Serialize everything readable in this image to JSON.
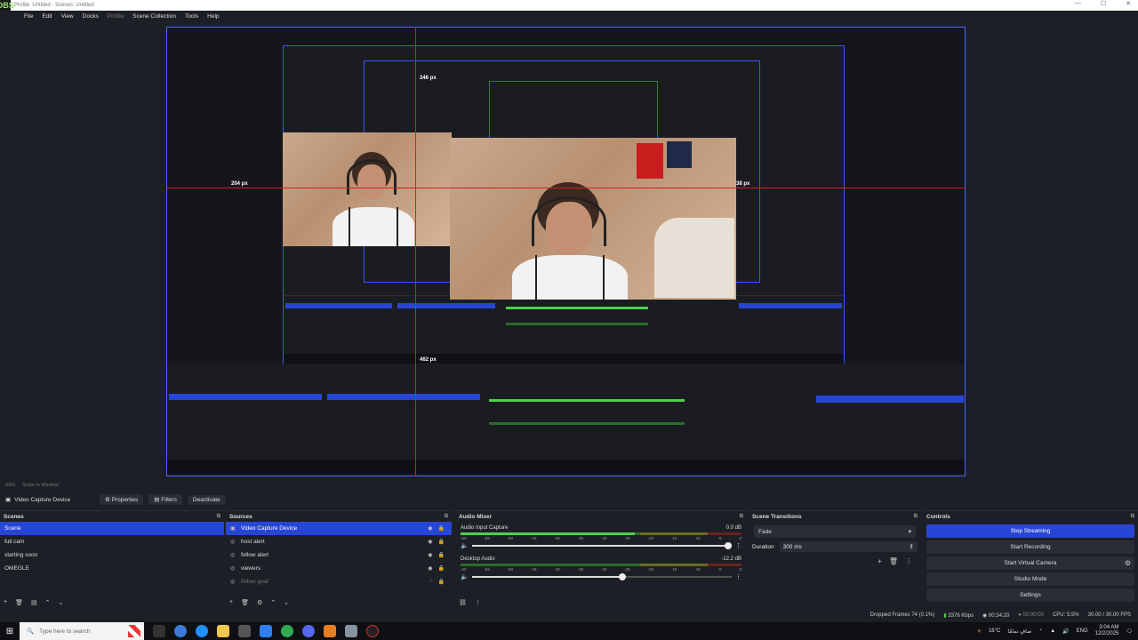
{
  "window": {
    "title": "Profile: Untitled - Scenes: Untitled",
    "logo": "OBS",
    "minimize": "—",
    "maximize": "☐",
    "close": "✕"
  },
  "menu": [
    {
      "label": "File"
    },
    {
      "label": "Edit"
    },
    {
      "label": "View"
    },
    {
      "label": "Docks"
    },
    {
      "label": "Profile"
    },
    {
      "label": "Scene Collection"
    },
    {
      "label": "Tools"
    },
    {
      "label": "Help"
    }
  ],
  "preview": {
    "labels": {
      "top": "346 px",
      "left": "204 px",
      "right": "38 px",
      "bottom": "462 px"
    }
  },
  "zoom": {
    "value": "93%",
    "mode": "Scale to Window"
  },
  "source_toolbar": {
    "source_name": "Video Capture Device",
    "properties": "Properties",
    "filters": "Filters",
    "deactivate": "Deactivate"
  },
  "scenes": {
    "title": "Scenes",
    "items": [
      "Scene",
      "full cam",
      "starting soon",
      "OMEGLE"
    ],
    "selected_index": 0
  },
  "sources": {
    "title": "Sources",
    "items": [
      {
        "name": "Video Capture Device",
        "icon": "camera-icon",
        "selected": true,
        "visible": true
      },
      {
        "name": "host alert",
        "icon": "browser-icon",
        "selected": false,
        "visible": true
      },
      {
        "name": "follow alert",
        "icon": "browser-icon",
        "selected": false,
        "visible": true
      },
      {
        "name": "viewers",
        "icon": "browser-icon",
        "selected": false,
        "visible": true
      },
      {
        "name": "follow goal",
        "icon": "browser-icon",
        "selected": false,
        "visible": false
      }
    ]
  },
  "audio_mixer": {
    "title": "Audio Mixer",
    "channels": [
      {
        "name": "Audio Input Capture",
        "db": "0.0 dB",
        "level": 0.62,
        "volume": 1.0
      },
      {
        "name": "Desktop Audio",
        "db": "-12.2 dB",
        "level": 0.0,
        "volume": 0.58
      }
    ],
    "tick_labels": [
      "-60",
      "-55",
      "-50",
      "-45",
      "-40",
      "-35",
      "-30",
      "-25",
      "-20",
      "-15",
      "-10",
      "-5",
      "0"
    ]
  },
  "scene_transitions": {
    "title": "Scene Transitions",
    "transition": "Fade",
    "duration_label": "Duration",
    "duration_value": "300 ms"
  },
  "controls": {
    "title": "Controls",
    "buttons": [
      "Stop Streaming",
      "Start Recording",
      "Start Virtual Camera",
      "Studio Mode",
      "Settings"
    ]
  },
  "status": {
    "dropped_frames": "Dropped Frames 74 (0.1%)",
    "bitrate": "3376 Kbps",
    "stream_time": "00:34:20",
    "rec_time": "00:00:00",
    "cpu": "CPU: 5.5%",
    "fps": "30.00 / 30.00 FPS"
  },
  "taskbar": {
    "search_placeholder": "Type here to search",
    "weather": "16°C",
    "weather_text": "صافٍ تمامًا",
    "lang": "ENG",
    "time": "3:04 AM",
    "date": "12/2/2025"
  },
  "colors": {
    "accent": "#2846d6",
    "guide_red": "#d32020",
    "frame_blue": "#4a66ff"
  }
}
